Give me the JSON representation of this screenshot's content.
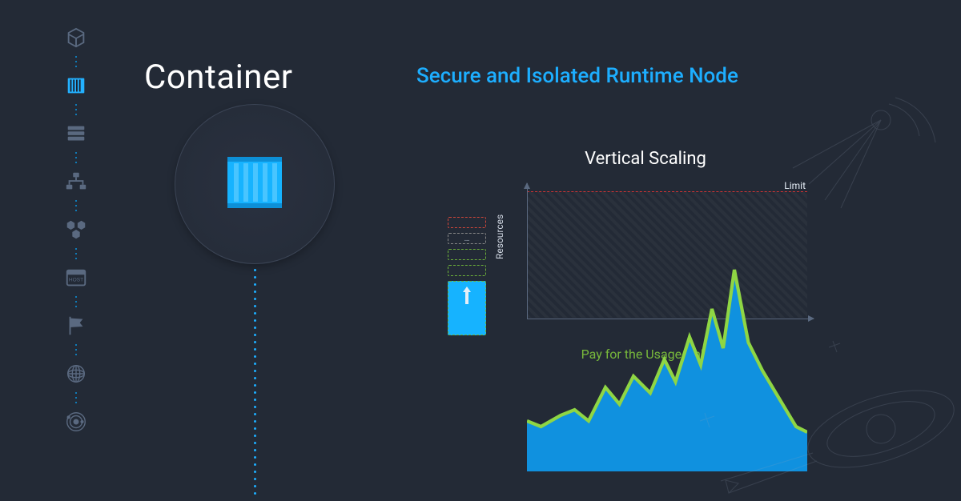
{
  "title": "Container",
  "subtitle": "Secure and Isolated Runtime Node",
  "rail": {
    "items": [
      {
        "name": "cube-icon",
        "active": false
      },
      {
        "name": "container-icon",
        "active": true
      },
      {
        "name": "database-icon",
        "active": false
      },
      {
        "name": "topology-icon",
        "active": false
      },
      {
        "name": "hexes-icon",
        "active": false
      },
      {
        "name": "host-icon",
        "active": false,
        "label": "HOST"
      },
      {
        "name": "flag-icon",
        "active": false
      },
      {
        "name": "globe-icon",
        "active": false
      },
      {
        "name": "orbit-icon",
        "active": false
      }
    ]
  },
  "cloudlet_stack": {
    "ellipsis": "…"
  },
  "chart_data": {
    "type": "area",
    "title": "Vertical Scaling",
    "xlabel": "",
    "ylabel": "Resources",
    "ylim": [
      0,
      100
    ],
    "limit_label": "Limit",
    "limit_value": 100,
    "caption": "Pay for the Usage Only",
    "x": [
      0,
      5,
      12,
      17,
      22,
      28,
      33,
      38,
      44,
      49,
      53,
      58,
      62,
      66,
      70,
      74,
      79,
      84,
      90,
      96,
      100
    ],
    "values": [
      18,
      16,
      20,
      22,
      18,
      30,
      24,
      34,
      28,
      40,
      32,
      48,
      38,
      58,
      44,
      72,
      46,
      36,
      26,
      16,
      14
    ]
  },
  "colors": {
    "accent": "#1daeff",
    "fill": "#1091df",
    "green": "#78b93b",
    "limit": "#c33"
  }
}
